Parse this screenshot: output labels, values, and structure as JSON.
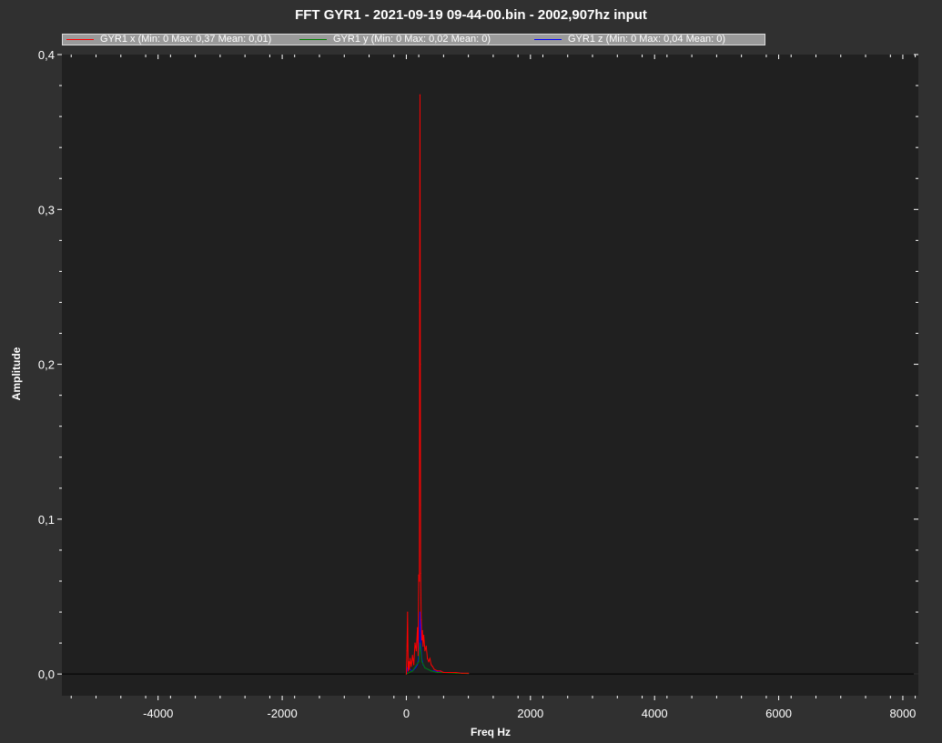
{
  "chart_data": {
    "type": "line",
    "title": "FFT GYR1 - 2021-09-19 09-44-00.bin - 2002,907hz input",
    "xlabel": "Freq Hz",
    "ylabel": "Amplitude",
    "xlim": [
      -5550,
      8250
    ],
    "ylim": [
      -0.014,
      0.4
    ],
    "x_ticks": [
      -4000,
      -2000,
      0,
      2000,
      4000,
      6000,
      8000
    ],
    "x_tick_labels": [
      "-4000",
      "-2000",
      "0",
      "2000",
      "4000",
      "6000",
      "8000"
    ],
    "y_ticks": [
      0.0,
      0.1,
      0.2,
      0.3,
      0.4
    ],
    "y_tick_labels": [
      "0,0",
      "0,1",
      "0,2",
      "0,3",
      "0,4"
    ],
    "grid": false,
    "legend_position": "top",
    "colors": {
      "background": "#303030",
      "plot_area": "#202020",
      "axis": "#ffffff"
    },
    "series": [
      {
        "name": "GYR1 x (Min: 0 Max: 0,37 Mean: 0,01)",
        "color": "#ff0000",
        "x": [
          0,
          10,
          20,
          30,
          40,
          50,
          60,
          80,
          100,
          120,
          140,
          160,
          180,
          190,
          200,
          210,
          215,
          220,
          225,
          230,
          240,
          250,
          260,
          270,
          280,
          300,
          320,
          340,
          360,
          380,
          400,
          420,
          450,
          500,
          550,
          600,
          700,
          800,
          900,
          1000
        ],
        "y": [
          0.0,
          0.015,
          0.04,
          0.002,
          0.008,
          0.003,
          0.01,
          0.005,
          0.012,
          0.006,
          0.02,
          0.015,
          0.03,
          0.012,
          0.064,
          0.06,
          0.24,
          0.374,
          0.2,
          0.065,
          0.035,
          0.022,
          0.028,
          0.018,
          0.025,
          0.015,
          0.018,
          0.01,
          0.008,
          0.01,
          0.006,
          0.005,
          0.003,
          0.002,
          0.002,
          0.001,
          0.001,
          0.001,
          0.0005,
          0.0005
        ]
      },
      {
        "name": "GYR1 y (Min: 0 Max: 0,02 Mean: 0)",
        "color": "#008000",
        "x": [
          0,
          100,
          200,
          220,
          250,
          300,
          400,
          500,
          600,
          800,
          1000
        ],
        "y": [
          0.0,
          0.002,
          0.008,
          0.02,
          0.008,
          0.004,
          0.002,
          0.001,
          0.001,
          0.0005,
          0.0003
        ]
      },
      {
        "name": "GYR1 z (Min: 0 Max: 0,04 Mean: 0)",
        "color": "#0000ff",
        "x": [
          0,
          20,
          50,
          100,
          150,
          180,
          200,
          210,
          220,
          230,
          240,
          250,
          270,
          300,
          350,
          400,
          450,
          500,
          600,
          700,
          800,
          900,
          1000
        ],
        "y": [
          0.0,
          0.004,
          0.003,
          0.002,
          0.004,
          0.006,
          0.012,
          0.02,
          0.04,
          0.03,
          0.015,
          0.01,
          0.006,
          0.004,
          0.003,
          0.002,
          0.002,
          0.0015,
          0.001,
          0.001,
          0.0008,
          0.0005,
          0.0003
        ]
      }
    ]
  }
}
